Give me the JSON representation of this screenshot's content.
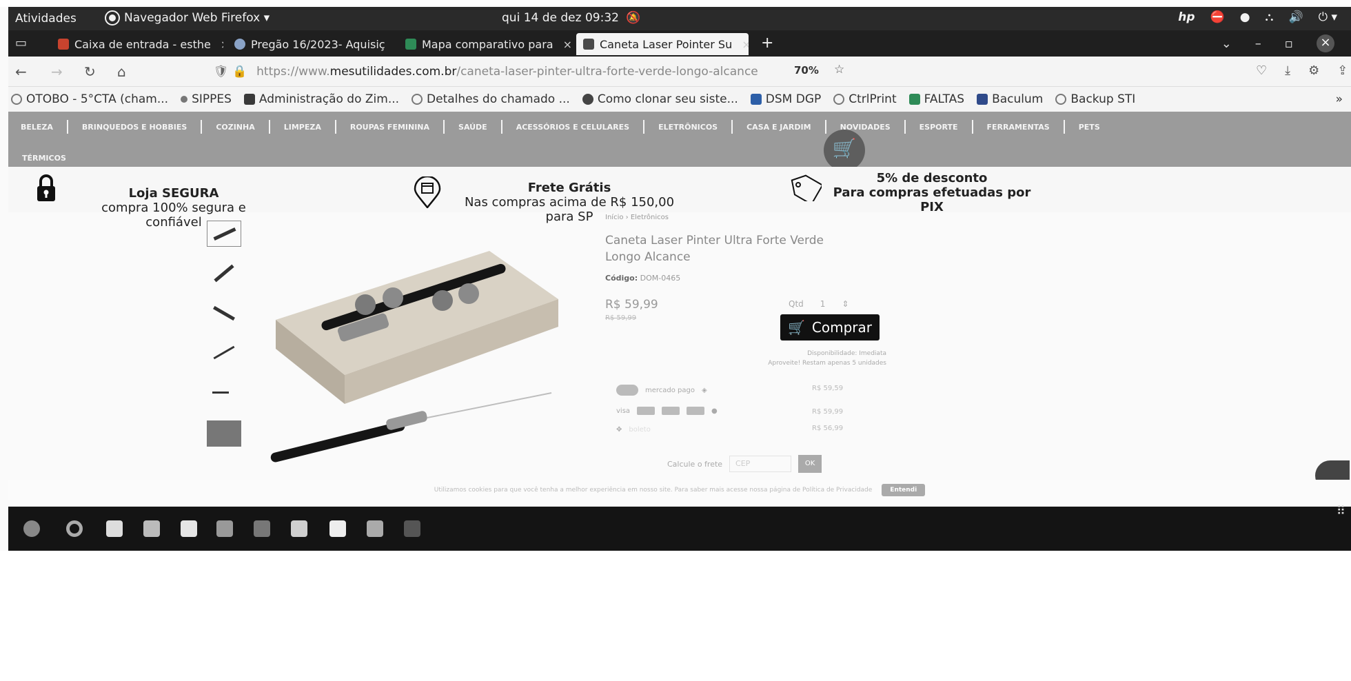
{
  "topbar": {
    "activities": "Atividades",
    "app_name": "Navegador Web Firefox ▾",
    "clock": "qui 14 de dez  09:32"
  },
  "tabs": [
    {
      "label": "Caixa de entrada - esthe",
      "favicon_color": "#c8432e"
    },
    {
      "label": "Pregão 16/2023- Aquisiç",
      "favicon_color": "#8aa3c7"
    },
    {
      "label": "Mapa comparativo para",
      "favicon_color": "#2e8b57"
    },
    {
      "label": "Caneta Laser Pointer Su",
      "favicon_color": "#4a4a4a"
    }
  ],
  "navbar": {
    "url_scheme": "https://www.",
    "url_host": "mesutilidades.com.br",
    "url_path": "/caneta-laser-pinter-ultra-forte-verde-longo-alcance",
    "zoom": "70%"
  },
  "bookmarks": [
    {
      "label": "OTOBO - 5°CTA (cham...",
      "icon": "check-circle-icon",
      "color": "#777"
    },
    {
      "label": "SIPPES",
      "icon": "gear-icon",
      "color": "#777"
    },
    {
      "label": "Administração do Zim...",
      "icon": "zimbra-icon",
      "color": "#3a3a3a"
    },
    {
      "label": "Detalhes do chamado ...",
      "icon": "globe-icon",
      "color": "#777"
    },
    {
      "label": "Como clonar seu siste...",
      "icon": "bookmark-icon",
      "color": "#444"
    },
    {
      "label": "DSM DGP",
      "icon": "dsm-icon",
      "color": "#2d5fa8"
    },
    {
      "label": "CtrlPrint",
      "icon": "globe-icon",
      "color": "#777"
    },
    {
      "label": "FALTAS",
      "icon": "sheet-icon",
      "color": "#2e8b57"
    },
    {
      "label": "Baculum",
      "icon": "baculum-icon",
      "color": "#2f4a8a"
    },
    {
      "label": "Backup STI",
      "icon": "globe-icon",
      "color": "#777"
    }
  ],
  "categories": [
    "BELEZA",
    "BRINQUEDOS E HOBBIES",
    "COZINHA",
    "LIMPEZA",
    "ROUPAS FEMININA",
    "SAÚDE",
    "ACESSÓRIOS E CELULARES",
    "ELETRÔNICOS",
    "CASA E JARDIM",
    "NOVIDADES",
    "ESPORTE",
    "FERRAMENTAS",
    "PETS"
  ],
  "categories_row2": "TÉRMICOS",
  "trust": {
    "secure_title": "Loja  SEGURA",
    "secure_sub": "compra 100% segura e confiável",
    "shipping_title": "Frete Grátis",
    "shipping_sub": "Nas compras acima de R$ 150,00  para SP",
    "discount_title": "5% de desconto",
    "discount_sub": "Para compras efetuadas por PIX"
  },
  "product": {
    "breadcrumb": "Início  ›  Eletrônicos",
    "title": "Caneta Laser Pinter Ultra Forte Verde Longo Alcance",
    "code_label": "Código:",
    "code_value": "DOM-0465",
    "price": "R$ 59,99",
    "old_price": "R$ 59,99",
    "qty_label": "Qtd",
    "qty_value": "1",
    "buy_label": "Comprar",
    "availability": "Disponibilidade: Imediata",
    "stock_note": "Aproveite! Restam apenas 5 unidades",
    "payments": [
      {
        "name": "mercado pago",
        "price": "R$ 59,59"
      },
      {
        "name": "visa",
        "price": "R$ 59,99"
      },
      {
        "name": "boleto",
        "price": "R$ 56,99"
      }
    ],
    "shipping_label": "Calcule o frete",
    "cep_placeholder": "CEP",
    "ok_label": "OK"
  },
  "cookie": {
    "text": "Utilizamos cookies para que você tenha a melhor experiência em nosso site. Para saber mais acesse nossa página de Política de Privacidade",
    "button": "Entendi"
  },
  "dock_apps": [
    "ubuntu-icon",
    "firefox-icon",
    "terminal-icon",
    "files-icon",
    "text-editor-icon",
    "calc-icon",
    "window-icon",
    "package-icon",
    "notes-icon",
    "vm-icon",
    "console-icon"
  ]
}
